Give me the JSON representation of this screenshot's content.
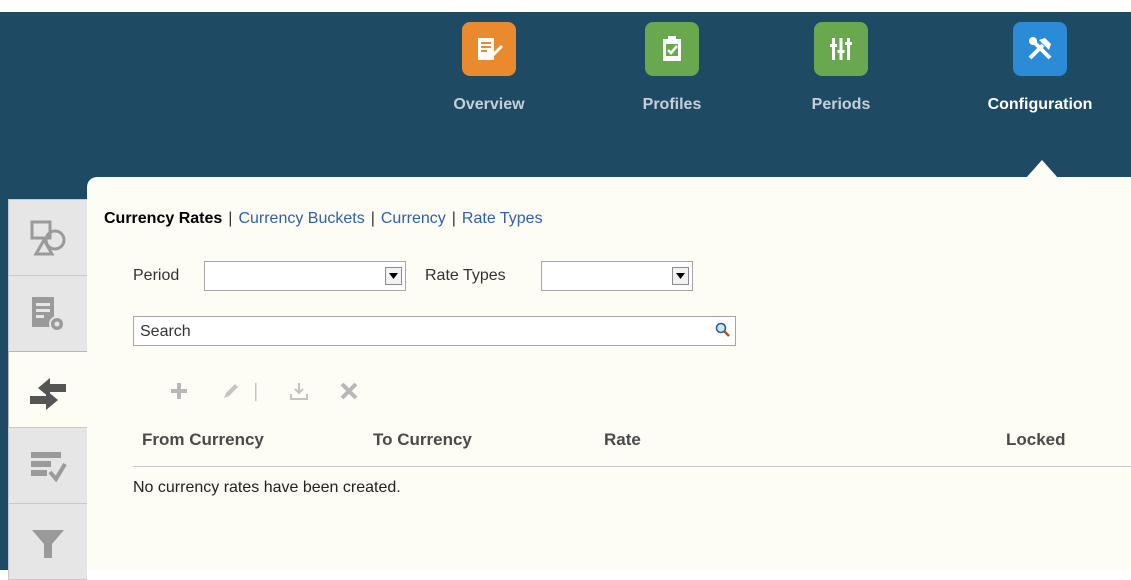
{
  "nav": {
    "items": [
      {
        "label": "Overview",
        "icon": "overview-icon",
        "color": "#ea8a2f"
      },
      {
        "label": "Profiles",
        "icon": "profiles-icon",
        "color": "#6aa84f"
      },
      {
        "label": "Periods",
        "icon": "periods-icon",
        "color": "#6aa84f"
      },
      {
        "label": "Configuration",
        "icon": "configuration-icon",
        "color": "#2c8bd6",
        "active": true
      }
    ]
  },
  "side_tabs": [
    {
      "icon": "shapes-icon"
    },
    {
      "icon": "form-settings-icon"
    },
    {
      "icon": "exchange-arrows-icon",
      "active": true
    },
    {
      "icon": "report-check-icon"
    },
    {
      "icon": "filter-icon"
    }
  ],
  "subnav": {
    "current": "Currency Rates",
    "links": [
      "Currency Buckets",
      "Currency",
      "Rate Types"
    ],
    "separator": "|"
  },
  "filters": {
    "period_label": "Period",
    "period_value": "",
    "rate_types_label": "Rate Types",
    "rate_types_value": ""
  },
  "search": {
    "placeholder": "Search"
  },
  "toolbar": {
    "buttons": [
      "add-icon",
      "edit-icon",
      "import-icon",
      "delete-icon"
    ]
  },
  "table": {
    "columns": [
      "From Currency",
      "To Currency",
      "Rate",
      "Locked"
    ],
    "empty_message": "No currency rates have been created."
  },
  "colors": {
    "header_bg": "#1f4a64",
    "panel_bg": "#fdfdf5",
    "link": "#2f5fad"
  }
}
